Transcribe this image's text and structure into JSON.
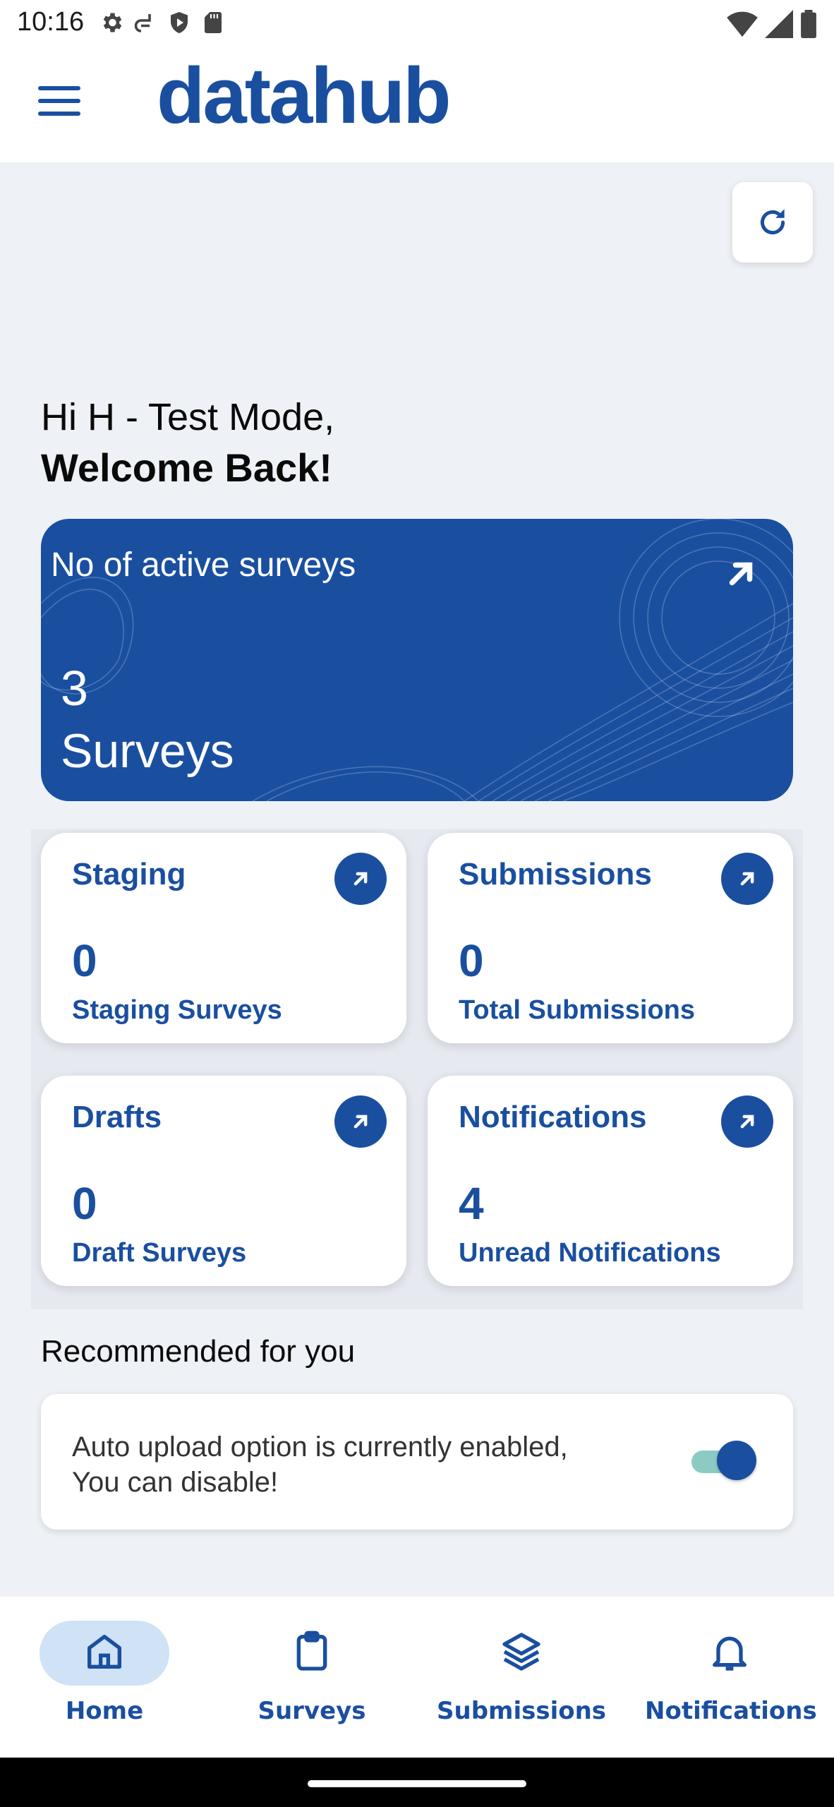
{
  "status_bar": {
    "time": "10:16",
    "icons": [
      "settings-icon",
      "sim-icon",
      "shield-play-icon",
      "sd-card-icon"
    ],
    "right_icons": [
      "wifi-icon",
      "signal-icon",
      "battery-icon"
    ]
  },
  "header": {
    "logo_text": "datahub",
    "menu_icon": "hamburger-menu-icon",
    "brand_color": "#1a4fa0"
  },
  "greeting": {
    "line1": "Hi H - Test Mode,",
    "line2": "Welcome Back!"
  },
  "hero_card": {
    "label": "No of active surveys",
    "count": "3",
    "unit": "Surveys",
    "bg_color": "#1a4fa0"
  },
  "stat_cards": [
    {
      "title": "Staging",
      "value": "0",
      "subtitle": "Staging Surveys"
    },
    {
      "title": "Submissions",
      "value": "0",
      "subtitle": "Total Submissions"
    },
    {
      "title": "Drafts",
      "value": "0",
      "subtitle": "Draft Surveys"
    },
    {
      "title": "Notifications",
      "value": "4",
      "subtitle": "Unread Notifications"
    }
  ],
  "recommended": {
    "title": "Recommended for you",
    "line1": "Auto upload option is currently enabled,",
    "line2": "You can disable!",
    "toggle_on": true
  },
  "bottom_nav": [
    {
      "label": "Home",
      "icon": "home-icon",
      "active": true
    },
    {
      "label": "Surveys",
      "icon": "clipboard-icon",
      "active": false
    },
    {
      "label": "Submissions",
      "icon": "layers-icon",
      "active": false
    },
    {
      "label": "Notifications",
      "icon": "bell-icon",
      "active": false
    }
  ]
}
